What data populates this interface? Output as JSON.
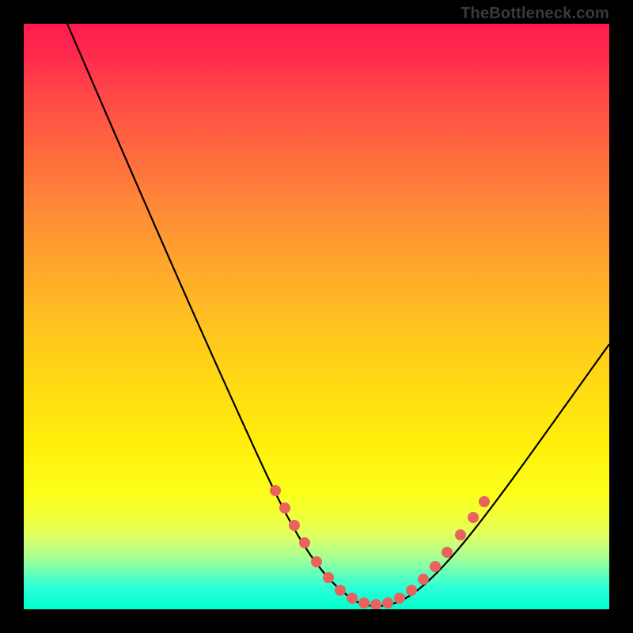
{
  "attribution": "TheBottleneck.com",
  "chart_data": {
    "type": "line",
    "title": "",
    "xlabel": "",
    "ylabel": "",
    "xlim": [
      0,
      100
    ],
    "ylim": [
      0,
      100
    ],
    "grid": false,
    "legend": false,
    "series": [
      {
        "name": "bottleneck-curve",
        "x": [
          0,
          5,
          10,
          15,
          20,
          25,
          30,
          35,
          40,
          42,
          44,
          46,
          48,
          50,
          52,
          54,
          56,
          58,
          60,
          62,
          64,
          66,
          68,
          70,
          75,
          80,
          85,
          90,
          95,
          100
        ],
        "y": [
          100,
          91,
          82,
          73,
          64,
          56,
          47,
          38,
          29,
          25,
          21,
          17,
          13,
          9,
          6,
          4,
          2.5,
          1.5,
          1,
          1,
          1.5,
          2.5,
          4.5,
          7,
          13,
          20,
          27,
          34,
          41,
          48
        ]
      },
      {
        "name": "highlight-markers",
        "x": [
          42,
          44,
          46,
          48,
          50,
          52,
          54,
          56,
          58,
          60,
          62,
          64,
          66,
          68,
          70,
          72,
          74,
          76
        ],
        "y": [
          25,
          21,
          17,
          13,
          9,
          6,
          4,
          2.5,
          1.5,
          1,
          1,
          1.5,
          2.5,
          4.5,
          7,
          9.5,
          12,
          14.5
        ]
      }
    ],
    "background_gradient": {
      "top": "#ff1a4d",
      "mid": "#ffdd00",
      "bottom": "#00ffcc"
    },
    "colors": {
      "curve": "#000000",
      "marker": "#e9635e"
    }
  }
}
